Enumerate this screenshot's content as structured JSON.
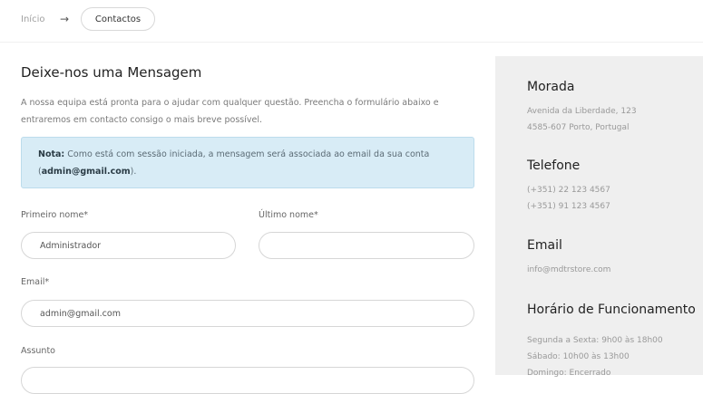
{
  "breadcrumb": {
    "home_label": "Início",
    "separator": "→",
    "current_label": "Contactos"
  },
  "form": {
    "title": "Deixe-nos uma Mensagem",
    "intro": "A nossa equipa está pronta para o ajudar com qualquer questão. Preencha o formulário abaixo e entraremos em contacto consigo o mais breve possível.",
    "note": {
      "label": "Nota:",
      "text_before": " Como está com sessão iniciada, a mensagem será associada ao email da sua conta (",
      "email": "admin@gmail.com",
      "text_after": ")."
    },
    "first_name": {
      "label": "Primeiro nome*",
      "value": "Administrador"
    },
    "last_name": {
      "label": "Último nome*",
      "value": ""
    },
    "email": {
      "label": "Email*",
      "value": "admin@gmail.com"
    },
    "subject": {
      "label": "Assunto",
      "value": ""
    }
  },
  "info": {
    "address": {
      "title": "Morada",
      "line1": "Avenida da Liberdade, 123",
      "line2": "4585-607 Porto, Portugal"
    },
    "phone": {
      "title": "Telefone",
      "line1": "(+351) 22 123 4567",
      "line2": "(+351) 91 123 4567"
    },
    "email": {
      "title": "Email",
      "line1": "info@mdtrstore.com"
    },
    "hours": {
      "title": "Horário de Funcionamento",
      "line1": "Segunda a Sexta: 9h00 às 18h00",
      "line2": "Sábado: 10h00 às 13h00",
      "line3": "Domingo: Encerrado"
    }
  },
  "colors": {
    "note_bg": "#d8ecf6",
    "info_bg": "#efefef"
  }
}
